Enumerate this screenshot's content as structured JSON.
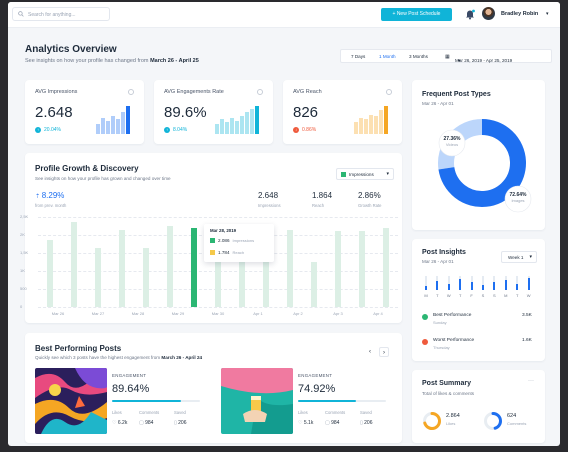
{
  "topbar": {
    "search_placeholder": "Search for anything...",
    "new_post_label": "+ New Post Schedule",
    "user_name": "Bradley Robin"
  },
  "header": {
    "title": "Analytics Overview",
    "subtitle_prefix": "See insights on how your profile has changed from",
    "subtitle_range": "March 26 - April 25",
    "periods": [
      "7 Days",
      "1 Month",
      "3 Months"
    ],
    "date_range": "Mar 26, 2019 - Apr 25, 2019"
  },
  "kpis": [
    {
      "label": "AVG Impressions",
      "value": "2.648",
      "change": "20.04%",
      "direction": "up",
      "color": "#1e6ff0",
      "bars": [
        0.35,
        0.55,
        0.45,
        0.6,
        0.5,
        0.72,
        0.95
      ]
    },
    {
      "label": "AVG Engagements Rate",
      "value": "89.6%",
      "change": "8.04%",
      "direction": "up",
      "color": "#10b4d8",
      "bars": [
        0.35,
        0.5,
        0.4,
        0.55,
        0.45,
        0.6,
        0.72,
        0.85,
        0.95
      ]
    },
    {
      "label": "AVG Reach",
      "value": "826",
      "change": "0.86%",
      "direction": "down",
      "color": "#f5a623",
      "bars": [
        0.4,
        0.55,
        0.5,
        0.65,
        0.6,
        0.8,
        0.95
      ]
    }
  ],
  "growth": {
    "title": "Profile Growth & Discovery",
    "subtitle": "See insights on how your profile has grown and changed over time",
    "dropdown": "Impressions",
    "main_value": "8.29%",
    "main_label": "from prev. month",
    "stats": [
      {
        "value": "2.648",
        "label": "Impressions"
      },
      {
        "value": "1.864",
        "label": "Reach"
      },
      {
        "value": "2.86%",
        "label": "Growth Rate"
      }
    ],
    "tooltip": {
      "date": "Mar 28, 2019",
      "rows": [
        {
          "value": "2.086",
          "label": "Impressions",
          "color": "#2bb673"
        },
        {
          "value": "1.784",
          "label": "Reach",
          "color": "#f5c94a"
        }
      ]
    }
  },
  "chart_data": {
    "type": "bar",
    "yticks": [
      "2,5K",
      "2K",
      "1,5K",
      "1K",
      "500",
      "0"
    ],
    "ylim": [
      0,
      2500
    ],
    "xticks": [
      "Mar 26",
      "Mar 27",
      "Mar 28",
      "Mar 29",
      "Mar 30",
      "Apr 1",
      "Apr 2",
      "Apr 3",
      "Apr 4"
    ],
    "series": [
      {
        "name": "Impressions",
        "values": [
          1850,
          2350,
          1650,
          2150,
          1650,
          2250,
          2200,
          2000,
          2100,
          1350,
          2150,
          1250,
          2100,
          2100,
          2200
        ]
      }
    ],
    "highlight_index": 6,
    "grid": true
  },
  "posts": {
    "title": "Best Performing Posts",
    "subtitle_prefix": "Quickly see which 3 posts have the highest engagement from",
    "subtitle_range": "March 26 - April 24",
    "items": [
      {
        "engagement_label": "ENGAGEMENT",
        "engagement": "89.64%",
        "progress": 0.78,
        "likes_label": "Likes",
        "likes": "6.2k",
        "comments_label": "Comments",
        "comments": "984",
        "saved_label": "Saved",
        "saved": "206"
      },
      {
        "engagement_label": "ENGAGEMENT",
        "engagement": "74.92%",
        "progress": 0.66,
        "likes_label": "Likes",
        "likes": "5.1k",
        "comments_label": "Comments",
        "comments": "984",
        "saved_label": "Saved",
        "saved": "206"
      }
    ]
  },
  "post_types": {
    "title": "Frequent Post Types",
    "range": "Mar 26 - Apr 01",
    "segments": [
      {
        "label": "Videos",
        "value": "27.36%",
        "fraction": 0.2736,
        "color": "#bcd6fb"
      },
      {
        "label": "Images",
        "value": "72.64%",
        "fraction": 0.7264,
        "color": "#1e6ff0"
      }
    ]
  },
  "insights": {
    "title": "Post Insights",
    "range": "Mar 26 - Apr 01",
    "dropdown": "Week 1",
    "days": [
      "M",
      "T",
      "W",
      "T",
      "F",
      "S",
      "S",
      "M",
      "T",
      "W"
    ],
    "levels": [
      0.3,
      0.65,
      0.45,
      0.8,
      0.55,
      0.35,
      0.6,
      0.7,
      0.4,
      0.85
    ],
    "best_label": "Best Performance",
    "best_day": "Sunday",
    "best_value": "3.5K",
    "worst_label": "Worst Performance",
    "worst_day": "Thursday",
    "worst_value": "1.6K"
  },
  "summary": {
    "title": "Post Summary",
    "subtitle": "Total of likes & comments",
    "items": [
      {
        "value": "2.864",
        "label": "Likes",
        "color": "#f5a623",
        "fraction": 0.7
      },
      {
        "value": "624",
        "label": "Comments",
        "color": "#1e6ff0",
        "fraction": 0.45
      }
    ]
  }
}
